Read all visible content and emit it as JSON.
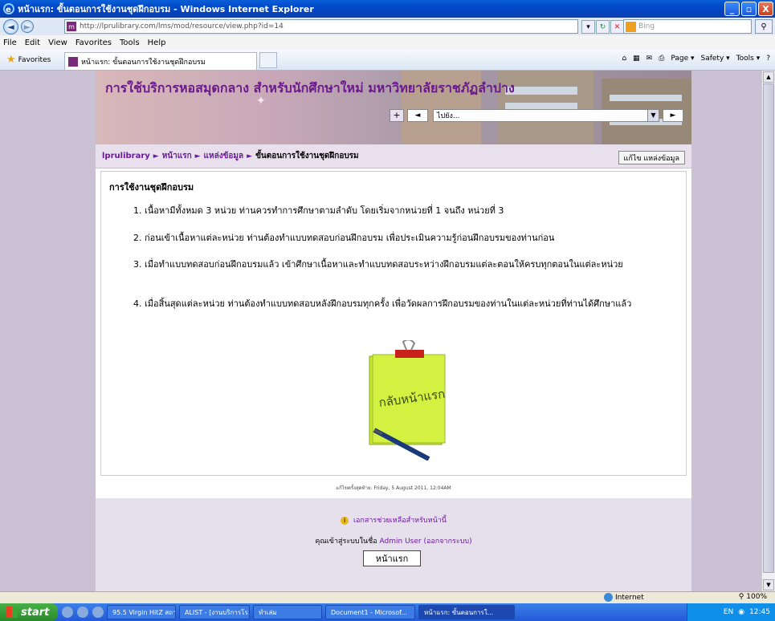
{
  "window": {
    "title": "หน้าแรก: ขั้นตอนการใช้งานชุดฝึกอบรม - Windows Internet Explorer",
    "minimize": "_",
    "maximize": "▫",
    "close": "X"
  },
  "address_bar": {
    "url": "http://lprulibrary.com/lms/mod/resource/view.php?id=14",
    "favicon_letter": "m",
    "search_placeholder": "Bing"
  },
  "menu": [
    "File",
    "Edit",
    "View",
    "Favorites",
    "Tools",
    "Help"
  ],
  "favorites_bar": {
    "favorites_label": "Favorites",
    "tab_title": "หน้าแรก: ขั้นตอนการใช้งานชุดฝึกอบรม",
    "tools": [
      "Page ▾",
      "Safety ▾",
      "Tools ▾"
    ]
  },
  "banner": {
    "title": "การใช้บริการหอสมุดกลาง สำหรับนักศึกษาใหม่ มหาวิทยาลัยราชภัฏลำปาง",
    "jump_placeholder": "ไปยัง...",
    "prev": "◄",
    "next": "►",
    "add": "+"
  },
  "breadcrumb": {
    "items": [
      "lprulibrary",
      "หน้าแรก",
      "แหล่งข้อมูล"
    ],
    "current": "ขั้นตอนการใช้งานชุดฝึกอบรม",
    "separator": "►",
    "edit_button": "แก้ไข แหล่งข้อมูล"
  },
  "content": {
    "heading": "การใช้งานชุดฝึกอบรม",
    "items": [
      "1. เนื้อหามีทั้งหมด 3 หน่วย ท่านควรทำการศึกษาตามลำดับ โดยเริ่มจากหน่วยที่ 1 จนถึง หน่วยที่ 3",
      "2. ก่อนเข้าเนื้อหาแต่ละหน่วย ท่านต้องทำแบบทดสอบก่อนฝึกอบรม เพื่อประเมินความรู้ก่อนฝึกอบรมของท่านก่อน",
      "3. เมื่อทำแบบทดสอบก่อนฝึกอบรมแล้ว เข้าศึกษาเนื้อหาและทำแบบทดสอบระหว่างฝึกอบรมแต่ละตอนให้ครบทุกตอนในแต่ละหน่วย",
      "4. เมื่อสิ้นสุดแต่ละหน่วย ท่านต้องทำแบบทดสอบหลังฝึกอบรมทุกครั้ง เพื่อวัดผลการฝึกอบรมของท่านในแต่ละหน่วยที่ท่านได้ศึกษาแล้ว"
    ],
    "note_button_text": "กลับหน้าแรก"
  },
  "footer": {
    "last_modified": "แก้ไขครั้งสุดท้าย: Friday, 5 August 2011, 12:04AM",
    "help_link": "เอกสารช่วยเหลือสำหรับหน้านี้",
    "login_prefix": "คุณเข้าสู่ระบบในชื่อ",
    "login_user": "Admin User",
    "logout": "(ออกจากระบบ)",
    "home_button": "หน้าแรก"
  },
  "status_bar": {
    "zone": "Internet",
    "zoom": "100%"
  },
  "taskbar": {
    "start": "start",
    "tasks": [
      "95.5 Virgin HitZ สถานี...",
      "ALIST - [งานบริการโร...",
      "ทำเล่ม",
      "Document1 - Microsof...",
      "หน้าแรก: ขั้นตอนการใ..."
    ],
    "lang": "EN",
    "time": "12:45"
  },
  "colors": {
    "accent": "#6a1a9a",
    "page_bg": "#cbc1d5",
    "note_green": "#c8e830"
  }
}
